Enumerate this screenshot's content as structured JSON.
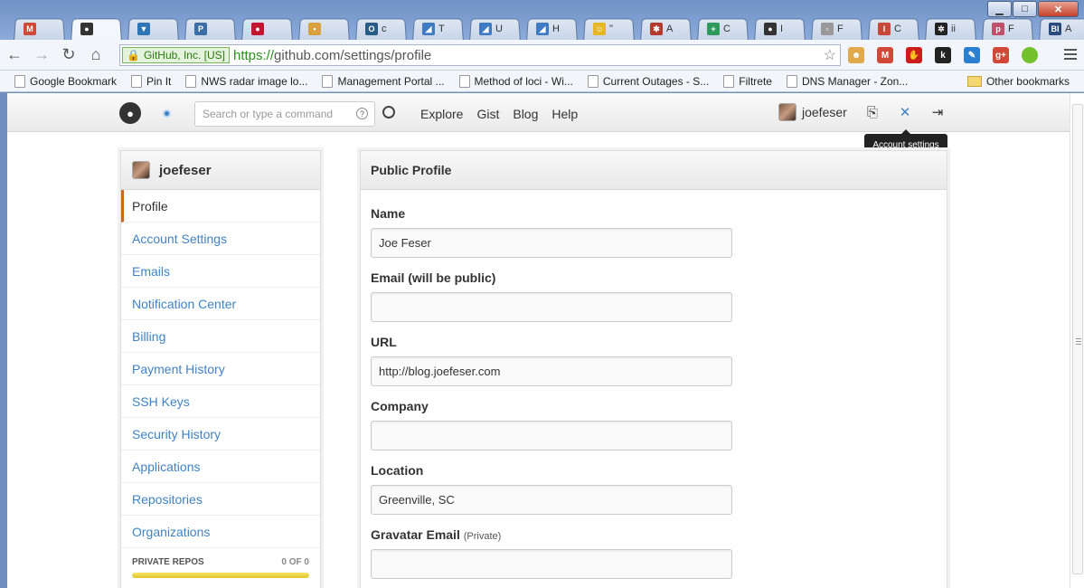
{
  "browser": {
    "tabs": [
      {
        "icon": "gmail-icon",
        "letter": "M",
        "color": "#d14836",
        "title": ""
      },
      {
        "icon": "github-icon",
        "letter": "●",
        "color": "#333333",
        "title": ""
      },
      {
        "icon": "bucket-icon",
        "letter": "▼",
        "color": "#2f74b5",
        "title": ""
      },
      {
        "icon": "p-icon",
        "letter": "P",
        "color": "#3b6ea5",
        "title": ""
      },
      {
        "icon": "record-icon",
        "letter": "●",
        "color": "#c2152f",
        "title": ""
      },
      {
        "icon": "photo-icon",
        "letter": "▪",
        "color": "#d8a03e",
        "title": ""
      },
      {
        "icon": "o-icon",
        "letter": "O",
        "color": "#2a5c88",
        "title": "c"
      },
      {
        "icon": "azure-icon",
        "letter": "◢",
        "color": "#3e7bc2",
        "title": "T"
      },
      {
        "icon": "azure-icon",
        "letter": "◢",
        "color": "#3e7bc2",
        "title": "U"
      },
      {
        "icon": "azure-icon",
        "letter": "◢",
        "color": "#3e7bc2",
        "title": "H"
      },
      {
        "icon": "smile-icon",
        "letter": "☺",
        "color": "#e5b52a",
        "title": "\""
      },
      {
        "icon": "bug-icon",
        "letter": "✱",
        "color": "#b33a2c",
        "title": "A"
      },
      {
        "icon": "plus-icon",
        "letter": "+",
        "color": "#2f9a5c",
        "title": "C"
      },
      {
        "icon": "github-icon",
        "letter": "●",
        "color": "#333333",
        "title": "I"
      },
      {
        "icon": "page-icon",
        "letter": "▫",
        "color": "#999999",
        "title": "F"
      },
      {
        "icon": "i-icon",
        "letter": "I",
        "color": "#c8483a",
        "title": "C"
      },
      {
        "icon": "asterisk-icon",
        "letter": "✲",
        "color": "#222222",
        "title": "ii"
      },
      {
        "icon": "pdf-icon",
        "letter": "p",
        "color": "#c0506a",
        "title": "F"
      },
      {
        "icon": "bi-icon",
        "letter": "BI",
        "color": "#2a4c7a",
        "title": "A"
      }
    ],
    "ev_label": "GitHub, Inc. [US]",
    "url_scheme": "https://",
    "url_rest": "github.com/settings/profile",
    "extensions": [
      {
        "icon": "cat-icon",
        "color": "#e2a94b",
        "letter": "☻"
      },
      {
        "icon": "gmail-icon",
        "color": "#d14836",
        "letter": "M"
      },
      {
        "icon": "stop-icon",
        "color": "#cc1c1c",
        "letter": "✋"
      },
      {
        "icon": "k-icon",
        "color": "#222222",
        "letter": "k"
      },
      {
        "icon": "pen-icon",
        "color": "#2a7fd1",
        "letter": "✎"
      },
      {
        "icon": "gplus-icon",
        "color": "#d14836",
        "letter": "g+"
      },
      {
        "icon": "green-dot-icon",
        "color": "#72c12d",
        "letter": ""
      }
    ],
    "bookmarks": [
      {
        "label": "Google Bookmark",
        "folder": false
      },
      {
        "label": "Pin It",
        "folder": false
      },
      {
        "label": "NWS radar image lo...",
        "folder": false
      },
      {
        "label": "Management Portal ...",
        "folder": false
      },
      {
        "label": "Method of loci - Wi...",
        "folder": false
      },
      {
        "label": "Current Outages - S...",
        "folder": false
      },
      {
        "label": "Filtrete",
        "folder": false
      },
      {
        "label": "DNS Manager - Zon...",
        "folder": false
      }
    ],
    "other_bookmarks": "Other bookmarks"
  },
  "header": {
    "search_placeholder": "Search or type a command",
    "nav": [
      "Explore",
      "Gist",
      "Blog",
      "Help"
    ],
    "username": "joefeser",
    "tooltip": "Account settings"
  },
  "sidebar": {
    "username": "joefeser",
    "items": [
      {
        "label": "Profile",
        "selected": true
      },
      {
        "label": "Account Settings",
        "selected": false
      },
      {
        "label": "Emails",
        "selected": false
      },
      {
        "label": "Notification Center",
        "selected": false
      },
      {
        "label": "Billing",
        "selected": false
      },
      {
        "label": "Payment History",
        "selected": false
      },
      {
        "label": "SSH Keys",
        "selected": false
      },
      {
        "label": "Security History",
        "selected": false
      },
      {
        "label": "Applications",
        "selected": false
      },
      {
        "label": "Repositories",
        "selected": false
      },
      {
        "label": "Organizations",
        "selected": false
      }
    ],
    "private_repos_label": "PRIVATE REPOS",
    "private_repos_count": "0 OF 0"
  },
  "profile": {
    "title": "Public Profile",
    "fields": [
      {
        "label": "Name",
        "note": "",
        "value": "Joe Feser"
      },
      {
        "label": "Email (will be public)",
        "note": "",
        "value": ""
      },
      {
        "label": "URL",
        "note": "",
        "value": "http://blog.joefeser.com"
      },
      {
        "label": "Company",
        "note": "",
        "value": ""
      },
      {
        "label": "Location",
        "note": "",
        "value": "Greenville, SC"
      },
      {
        "label": "Gravatar Email",
        "note": "(Private)",
        "value": ""
      }
    ]
  }
}
